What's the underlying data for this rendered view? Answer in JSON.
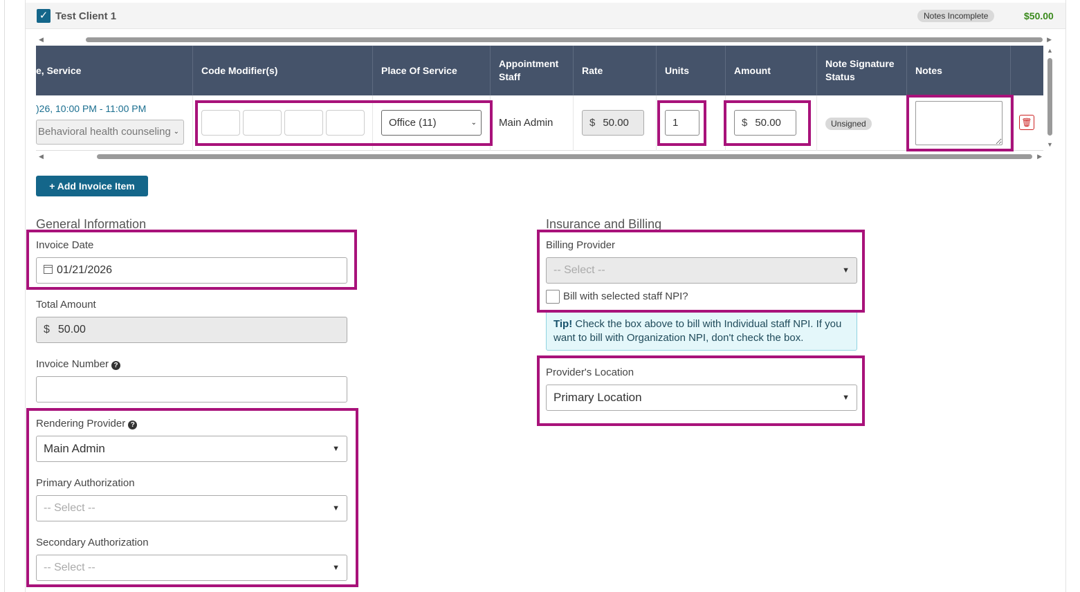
{
  "client": {
    "name": "Test Client 1",
    "checked": true,
    "status_badge": "Notes Incomplete",
    "total": "$50.00"
  },
  "table": {
    "columns": [
      "e, Service",
      "Code Modifier(s)",
      "Place Of Service",
      "Appointment Staff",
      "Rate",
      "Units",
      "Amount",
      "Note Signature Status",
      "Notes"
    ],
    "row": {
      "date_time": ")26, 10:00 PM - 11:00 PM",
      "service": "Behavioral health counseling",
      "modifiers": [
        "",
        "",
        "",
        ""
      ],
      "place_of_service": "Office (11)",
      "staff": "Main Admin",
      "rate_currency": "$",
      "rate": "50.00",
      "units": "1",
      "amount_currency": "$",
      "amount": "50.00",
      "signature_status": "Unsigned",
      "notes": ""
    }
  },
  "add_invoice_item_label": "+ Add Invoice Item",
  "general": {
    "title": "General Information",
    "invoice_date_label": "Invoice Date",
    "invoice_date": "01/21/2026",
    "total_amount_label": "Total Amount",
    "total_currency": "$",
    "total_amount": "50.00",
    "invoice_number_label": "Invoice Number",
    "invoice_number": "",
    "rendering_provider_label": "Rendering Provider",
    "rendering_provider": "Main Admin",
    "primary_auth_label": "Primary Authorization",
    "primary_auth": "-- Select --",
    "secondary_auth_label": "Secondary Authorization",
    "secondary_auth": "-- Select --"
  },
  "insurance": {
    "title": "Insurance and Billing",
    "billing_provider_label": "Billing Provider",
    "billing_provider": "-- Select --",
    "bill_npi_label": "Bill with selected staff NPI?",
    "tip_bold": "Tip!",
    "tip_text": " Check the box above to bill with Individual staff NPI. If you want to bill with Organization NPI, don't check the box.",
    "location_label": "Provider's Location",
    "location": "Primary Location"
  },
  "colors": {
    "header_bg": "#45536a",
    "brand": "#14668a",
    "highlight": "#a8127a",
    "total_green": "#3a8a1c"
  }
}
